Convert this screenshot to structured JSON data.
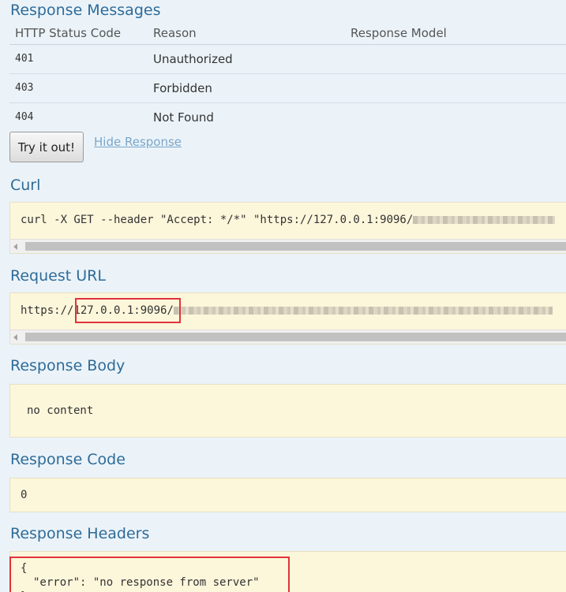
{
  "response_messages": {
    "title": "Response Messages",
    "columns": [
      "HTTP Status Code",
      "Reason",
      "Response Model"
    ],
    "rows": [
      {
        "code": "401",
        "reason": "Unauthorized",
        "model": ""
      },
      {
        "code": "403",
        "reason": "Forbidden",
        "model": ""
      },
      {
        "code": "404",
        "reason": "Not Found",
        "model": ""
      }
    ]
  },
  "actions": {
    "try_button": "Try it out!",
    "hide_link": "Hide Response"
  },
  "curl": {
    "title": "Curl",
    "command": "curl -X GET --header \"Accept: */*\" \"https://127.0.0.1:9096/"
  },
  "request_url": {
    "title": "Request URL",
    "prefix": "https://",
    "host": "127.0.0.1:9096",
    "slash": "/"
  },
  "response_body": {
    "title": "Response Body",
    "value": "no content"
  },
  "response_code": {
    "title": "Response Code",
    "value": "0"
  },
  "response_headers": {
    "title": "Response Headers",
    "open_brace": "{",
    "line": "\"error\": \"no response from server\"",
    "close_brace": "}"
  }
}
